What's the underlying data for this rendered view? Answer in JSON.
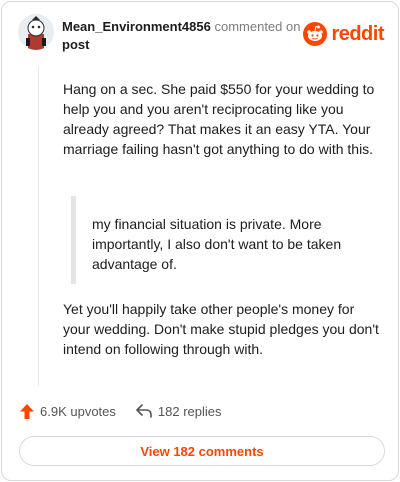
{
  "comment": {
    "username": "Mean_Environment4856",
    "commented_on": "commented on",
    "post_link": "post",
    "brand": "reddit",
    "paragraph1": "Hang on a sec. She paid $550 for your wedding to help you and you aren't reciprocating like you already agreed? That makes it an easy YTA. Your marriage failing hasn't got anything to do with this.",
    "quote": "my financial situation is private. More importantly, I also don't want to be taken advantage of.",
    "paragraph2": "Yet you'll happily take other people's money for your wedding. Don't make stupid pledges you don't intend on following through with."
  },
  "actions": {
    "upvotes": "6.9K upvotes",
    "replies": "182 replies",
    "view_comments": "View 182 comments"
  },
  "colors": {
    "brand": "#ff4500",
    "text": "#1c1c1c",
    "muted": "#7c7c7c"
  },
  "icons": [
    "avatar-icon",
    "reddit-logo-icon",
    "upvote-arrow-icon",
    "reply-arrow-icon"
  ]
}
